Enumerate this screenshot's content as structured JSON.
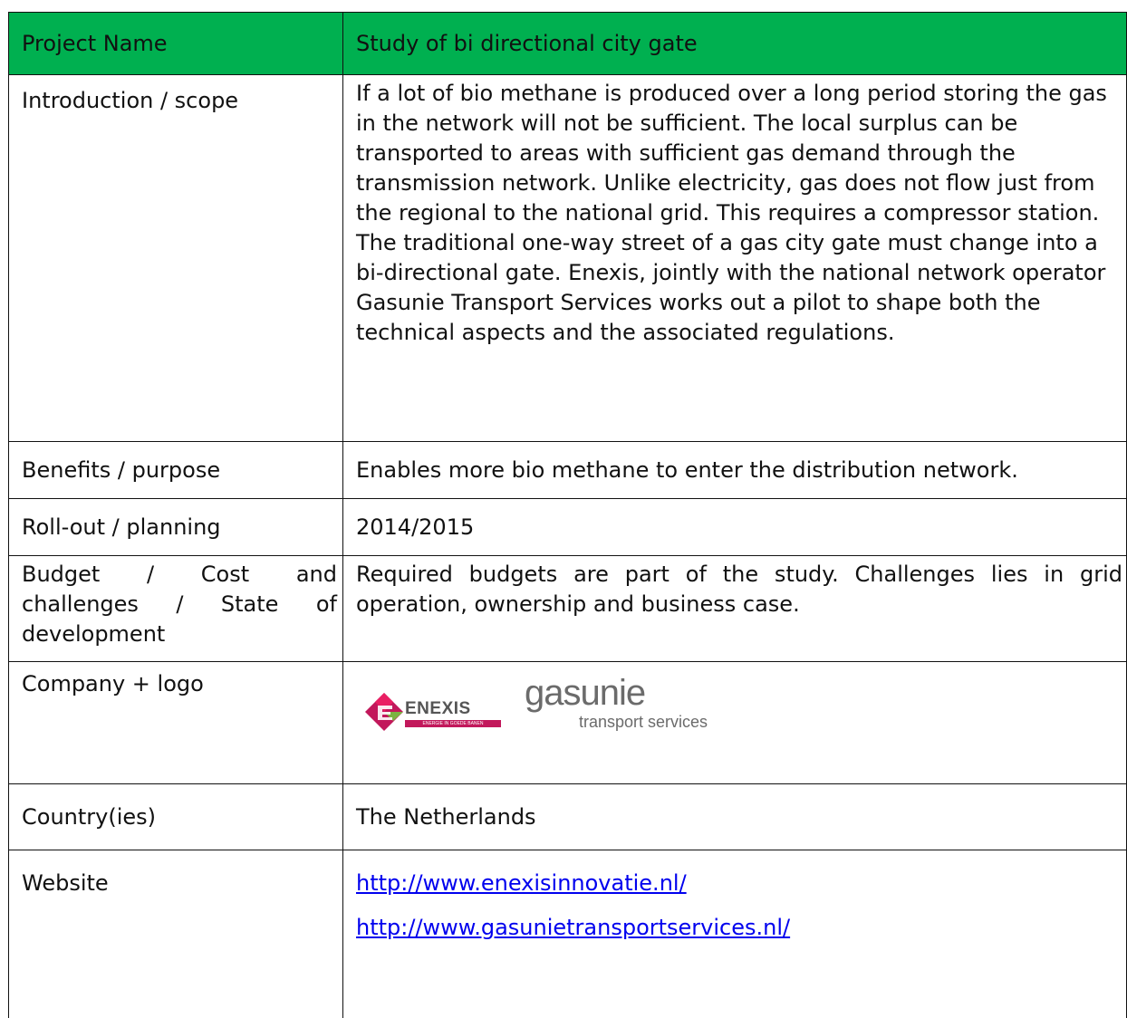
{
  "rows": {
    "project_name": {
      "label": "Project Name",
      "value": "Study of bi directional city gate"
    },
    "introduction": {
      "label": "Introduction / scope",
      "value": "If a lot of bio methane is produced over a long period storing the gas in the network will not be sufficient. The local surplus can be transported to areas with sufficient gas demand through the transmission network. Unlike electricity, gas does not flow just from the regional to the national grid. This requires a compressor station. The traditional one-way street of a gas city gate must change into a bi-directional gate. Enexis, jointly with the national network operator Gasunie Transport Services works out a pilot to shape both the technical aspects and the associated regulations."
    },
    "benefits": {
      "label": "Benefits / purpose",
      "value": "Enables more bio methane to enter the distribution network."
    },
    "rollout": {
      "label": "Roll-out / planning",
      "value": "2014/2015"
    },
    "budget": {
      "label": "Budget / Cost and challenges / State of development",
      "value": "Required budgets are part of the study. Challenges lies in grid operation, ownership and business case."
    },
    "company": {
      "label": "Company + logo",
      "logos": {
        "enexis": {
          "name": "ENEXIS",
          "tagline": "ENERGIE IN GOEDE BANEN"
        },
        "gasunie": {
          "name": "gasunie",
          "tagline": "transport services"
        }
      }
    },
    "country": {
      "label": "Country(ies)",
      "value": "The Netherlands"
    },
    "website": {
      "label": "Website",
      "links": [
        "http://www.enexisinnovatie.nl/",
        "http://www.gasunietransportservices.nl/"
      ]
    }
  },
  "colors": {
    "header_bg": "#00b050",
    "link": "#0000ee",
    "enexis_magenta": "#c2185b",
    "enexis_green": "#7cb342",
    "gasunie_grey": "#6b6b6b"
  }
}
